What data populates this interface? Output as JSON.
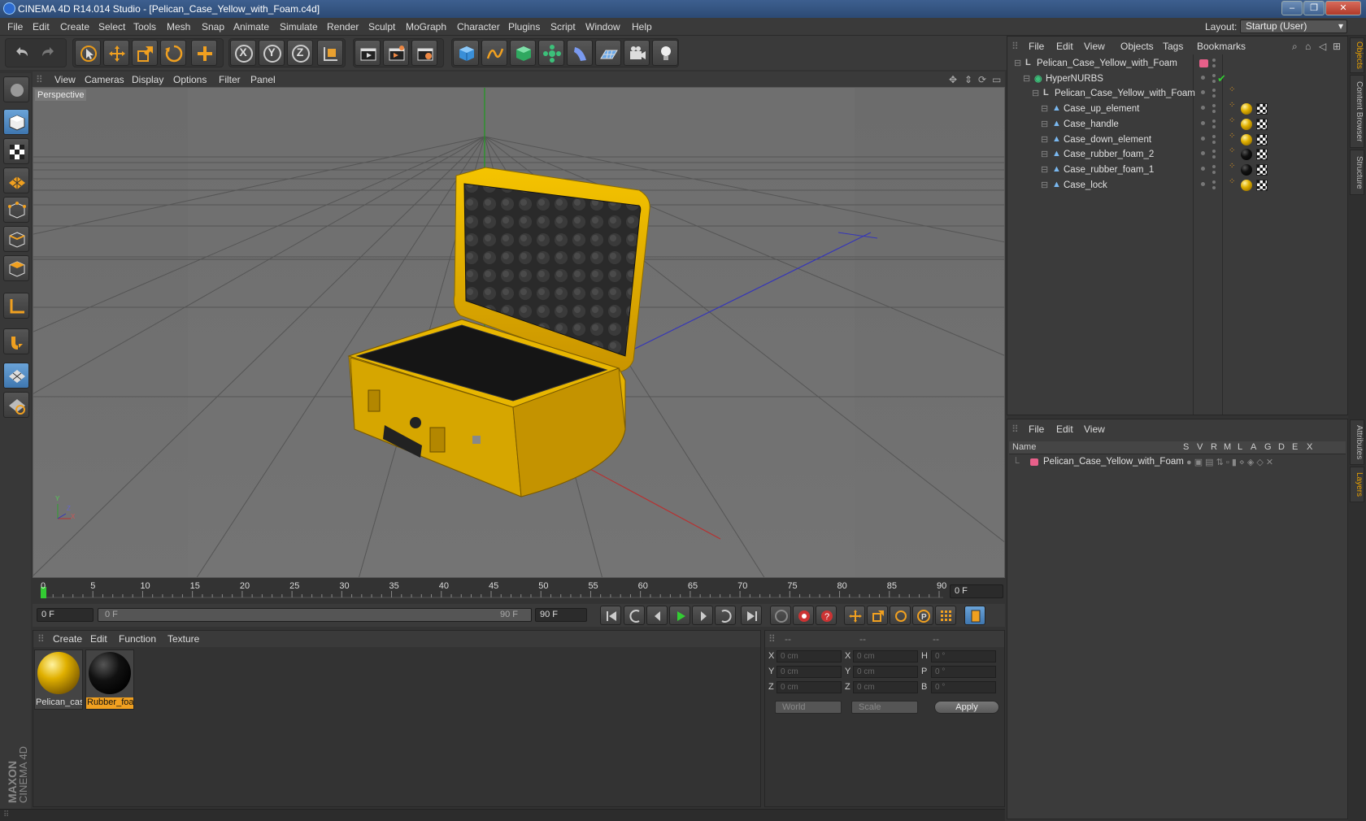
{
  "window": {
    "title": "CINEMA 4D R14.014 Studio - [Pelican_Case_Yellow_with_Foam.c4d]"
  },
  "menu": [
    "File",
    "Edit",
    "Create",
    "Select",
    "Tools",
    "Mesh",
    "Snap",
    "Animate",
    "Simulate",
    "Render",
    "Sculpt",
    "MoGraph",
    "Character",
    "Plugins",
    "Script",
    "Window",
    "Help"
  ],
  "layout": {
    "label": "Layout:",
    "value": "Startup (User)"
  },
  "toolbar": {
    "icons": [
      "undo-icon",
      "redo-icon",
      "live-select-icon",
      "move-icon",
      "scale-icon",
      "rotate-icon",
      "add-icon",
      "x-axis-icon",
      "y-axis-icon",
      "z-axis-icon",
      "coordinate-system-icon",
      "render-view-icon",
      "render-picture-viewer-icon",
      "render-settings-icon",
      "cube-icon",
      "spline-pen-icon",
      "nurbs-icon",
      "array-icon",
      "deformer-icon",
      "floor-icon",
      "camera-icon",
      "light-icon"
    ],
    "axis_x": "X",
    "axis_y": "Y",
    "axis_z": "Z"
  },
  "viewport": {
    "menu": [
      "View",
      "Cameras",
      "Display",
      "Options",
      "Filter",
      "Panel"
    ],
    "label": "Perspective",
    "axis_y": "Y",
    "axis_z": "Z",
    "axis_x": "X"
  },
  "timeline": {
    "ticks": [
      "0",
      "5",
      "10",
      "15",
      "20",
      "25",
      "30",
      "35",
      "40",
      "45",
      "50",
      "55",
      "60",
      "65",
      "70",
      "75",
      "80",
      "85",
      "90"
    ],
    "current_frame": "0 F",
    "start_field": "0 F",
    "range_start": "0 F",
    "range_end": "90 F",
    "end_field": "90 F"
  },
  "materials": {
    "menu": [
      "Create",
      "Edit",
      "Function",
      "Texture"
    ],
    "items": [
      {
        "name": "Pelican_cas",
        "color": "#d9a800",
        "selected": false
      },
      {
        "name": "Rubber_foa",
        "color": "#111111",
        "selected": true
      }
    ]
  },
  "coordinates": {
    "header": [
      "--",
      "--",
      "--"
    ],
    "rows": [
      {
        "a": "X",
        "av": "0 cm",
        "b": "X",
        "bv": "0 cm",
        "c": "H",
        "cv": "0 °"
      },
      {
        "a": "Y",
        "av": "0 cm",
        "b": "Y",
        "bv": "0 cm",
        "c": "P",
        "cv": "0 °"
      },
      {
        "a": "Z",
        "av": "0 cm",
        "b": "Z",
        "bv": "0 cm",
        "c": "B",
        "cv": "0 °"
      }
    ],
    "space": "World",
    "mode": "Scale",
    "apply": "Apply"
  },
  "objects": {
    "menu": [
      "File",
      "Edit",
      "View",
      "Objects",
      "Tags",
      "Bookmarks"
    ],
    "tree": [
      {
        "name": "Pelican_Case_Yellow_with_Foam",
        "indent": 0,
        "type": "null",
        "tag": "layer"
      },
      {
        "name": "HyperNURBS",
        "indent": 1,
        "type": "nurbs",
        "tag": "check"
      },
      {
        "name": "Pelican_Case_Yellow_with_Foam",
        "indent": 2,
        "type": "null",
        "tag": "none"
      },
      {
        "name": "Case_up_element",
        "indent": 3,
        "type": "poly",
        "tag": "yellow"
      },
      {
        "name": "Case_handle",
        "indent": 3,
        "type": "poly",
        "tag": "yellow"
      },
      {
        "name": "Case_down_element",
        "indent": 3,
        "type": "poly",
        "tag": "yellow"
      },
      {
        "name": "Case_rubber_foam_2",
        "indent": 3,
        "type": "poly",
        "tag": "black"
      },
      {
        "name": "Case_rubber_foam_1",
        "indent": 3,
        "type": "poly",
        "tag": "black"
      },
      {
        "name": "Case_lock",
        "indent": 3,
        "type": "poly",
        "tag": "yellow"
      }
    ]
  },
  "layers": {
    "menu": [
      "File",
      "Edit",
      "View"
    ],
    "columns": [
      "Name",
      "S",
      "V",
      "R",
      "M",
      "L",
      "A",
      "G",
      "D",
      "E",
      "X"
    ],
    "items": [
      {
        "name": "Pelican_Case_Yellow_with_Foam",
        "color": "#e8608a"
      }
    ]
  },
  "side_tabs": [
    "Objects",
    "Content Browser",
    "Structure",
    "Attributes",
    "Layers"
  ],
  "branding": {
    "maxon": "MAXON",
    "cinema": "CINEMA 4D"
  }
}
